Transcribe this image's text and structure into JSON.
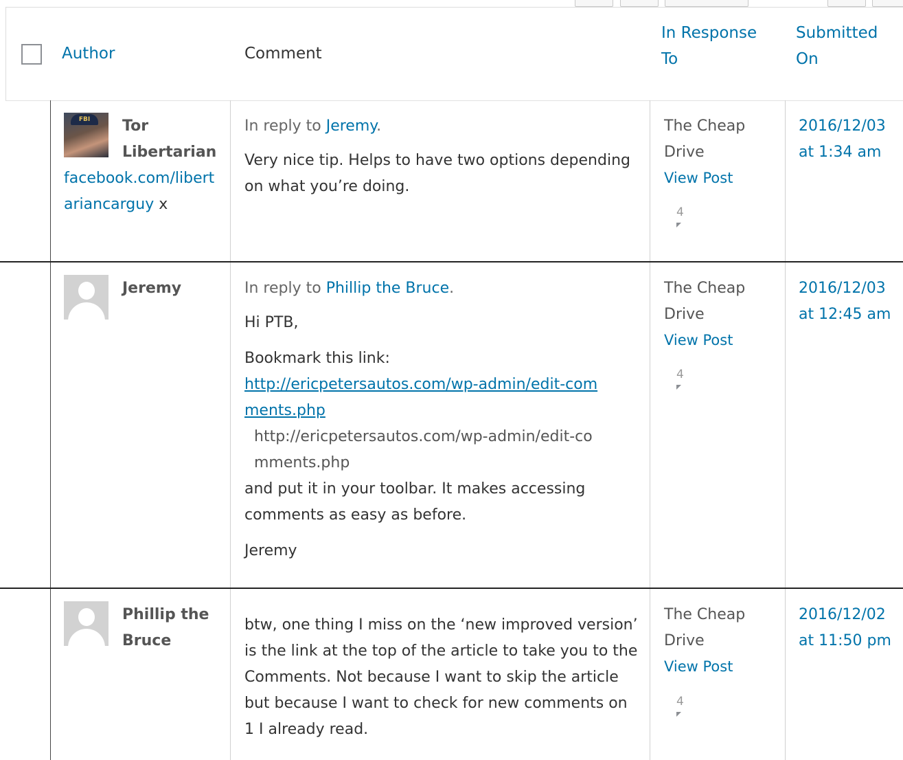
{
  "header": {
    "author": "Author",
    "comment": "Comment",
    "in_response_to": "In Response To",
    "submitted_on": "Submitted On"
  },
  "rows": [
    {
      "author": "Tor Libertarian",
      "author_url": "facebook.com/libertariancarguy",
      "author_url_suffix": "x",
      "avatar": "photo",
      "reply_prefix": "In reply to ",
      "reply_to": "Jeremy",
      "reply_suffix": ".",
      "paragraphs": [
        "Very nice tip. Helps to have two options depending on what you’re doing."
      ],
      "response_post": "The Cheap Drive",
      "view_post": "View Post",
      "comment_count": "4",
      "submitted": "2016/12/03 at 1:34 am"
    },
    {
      "author": "Jeremy",
      "avatar": "generic",
      "reply_prefix": "In reply to ",
      "reply_to": "Phillip the Bruce",
      "reply_suffix": ".",
      "greeting": "Hi PTB,",
      "bookmark_text": "Bookmark this link:",
      "link": "http://ericpetersautos.com/wp-admin/edit-comments.php",
      "link_plain": "http://ericpetersautos.com/wp-admin/edit-comments.php",
      "after_link": "and put it in your toolbar. It makes accessing comments as easy as before.",
      "signoff": "Jeremy",
      "response_post": "The Cheap Drive",
      "view_post": "View Post",
      "comment_count": "4",
      "submitted": "2016/12/03 at 12:45 am"
    },
    {
      "author": "Phillip the Bruce",
      "avatar": "generic",
      "paragraphs": [
        "btw, one thing I miss on the ‘new improved version’ is the link at the top of the article to take you to the Comments. Not because I want to skip the article but because I want to check for new comments on 1 I already read."
      ],
      "response_post": "The Cheap Drive",
      "view_post": "View Post",
      "comment_count": "4",
      "submitted": "2016/12/02 at 11:50 pm"
    }
  ],
  "icons": {
    "check_all": "checkbox-icon",
    "comment_count": "comment-bubble-icon"
  }
}
